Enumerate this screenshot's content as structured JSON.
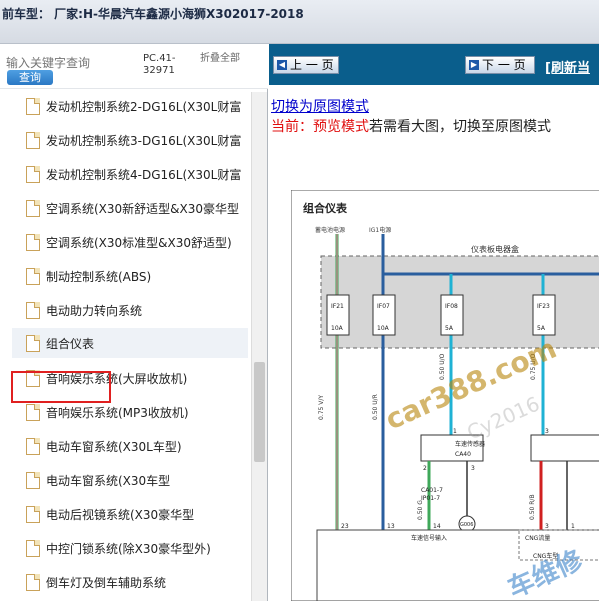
{
  "title": "前车型： 厂家:H-华晨汽车鑫源小海狮X302017-2018",
  "search": {
    "placeholder": "输入关键字查询",
    "button": "查询",
    "code": "PC.41-32971",
    "fold": "折叠全部"
  },
  "tree": [
    {
      "label": "发动机控制系统2-DG16L(X30L财富"
    },
    {
      "label": "发动机控制系统3-DG16L(X30L财富"
    },
    {
      "label": "发动机控制系统4-DG16L(X30L财富"
    },
    {
      "label": "空调系统(X30新舒适型&X30豪华型"
    },
    {
      "label": "空调系统(X30标准型&X30舒适型)"
    },
    {
      "label": "制动控制系统(ABS)"
    },
    {
      "label": "电动助力转向系统"
    },
    {
      "label": "组合仪表",
      "selected": true
    },
    {
      "label": "音响娱乐系统(大屏收放机)"
    },
    {
      "label": "音响娱乐系统(MP3收放机)"
    },
    {
      "label": "电动车窗系统(X30L车型)"
    },
    {
      "label": "电动车窗系统(X30车型"
    },
    {
      "label": "电动后视镜系统(X30豪华型"
    },
    {
      "label": "中控门锁系统(除X30豪华型外)"
    },
    {
      "label": "倒车灯及倒车辅助系统"
    }
  ],
  "nav": {
    "prev": "上 一 页",
    "next": "下 一 页",
    "refresh": "[刷新当"
  },
  "switch_link": "切换为原图模式",
  "current": {
    "prefix": "当前：",
    "mode": "预览模式",
    "suffix": "若需看大图，切换至原图模式"
  },
  "diagram": {
    "title": "组合仪表",
    "top_labels": [
      "蓄电池电源",
      "IG1电源"
    ],
    "fusebox": "仪表板电器盒",
    "fuses": [
      {
        "name": "IF21",
        "rating": "10A"
      },
      {
        "name": "IF07",
        "rating": "10A"
      },
      {
        "name": "IF08",
        "rating": "5A"
      },
      {
        "name": "IF23",
        "rating": "5A"
      }
    ],
    "wire_labels": [
      "0.75 V/Y",
      "0.50 U/R",
      "0.50 U/O",
      "0.50 G",
      "0.50 R/B",
      "0.75 U/O"
    ],
    "sensor": {
      "name": "车速传感器",
      "code": "CA40"
    },
    "connector": [
      "CA01-7",
      "IP01-7"
    ],
    "pins": [
      "1",
      "2",
      "3",
      "3",
      "23",
      "13",
      "14",
      "3",
      "1"
    ],
    "ground": "G006",
    "bottom_labels": [
      "车速信号输入",
      "CNG流量",
      "CNG车型"
    ],
    "watermarks": [
      "car388.com",
      "Cy2016",
      "车维修"
    ],
    "colors": {
      "wire_green": "#3fa85a",
      "wire_blue": "#2a5e9e",
      "wire_cyan": "#1fb2d4",
      "wire_pink": "#b68a8a",
      "wire_red": "#d02020"
    }
  }
}
